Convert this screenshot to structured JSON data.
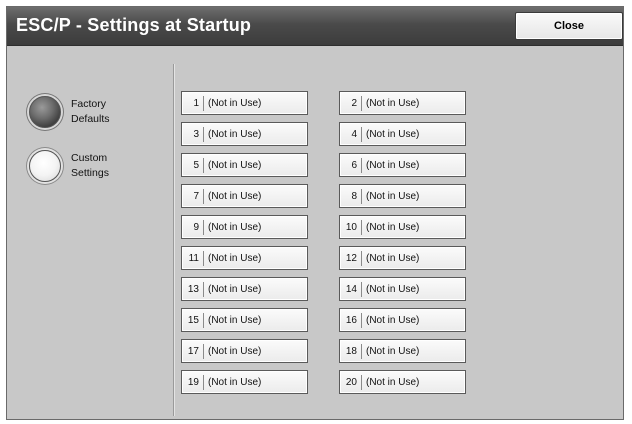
{
  "header": {
    "title": "ESC/P - Settings at Startup",
    "close_label": "Close"
  },
  "options": [
    {
      "label_line1": "Factory",
      "label_line2": "Defaults",
      "selected": true
    },
    {
      "label_line1": "Custom",
      "label_line2": "Settings",
      "selected": false
    }
  ],
  "settings": [
    {
      "num": "1",
      "label": "(Not in Use)"
    },
    {
      "num": "2",
      "label": "(Not in Use)"
    },
    {
      "num": "3",
      "label": "(Not in Use)"
    },
    {
      "num": "4",
      "label": "(Not in Use)"
    },
    {
      "num": "5",
      "label": "(Not in Use)"
    },
    {
      "num": "6",
      "label": "(Not in Use)"
    },
    {
      "num": "7",
      "label": "(Not in Use)"
    },
    {
      "num": "8",
      "label": "(Not in Use)"
    },
    {
      "num": "9",
      "label": "(Not in Use)"
    },
    {
      "num": "10",
      "label": "(Not in Use)"
    },
    {
      "num": "11",
      "label": "(Not in Use)"
    },
    {
      "num": "12",
      "label": "(Not in Use)"
    },
    {
      "num": "13",
      "label": "(Not in Use)"
    },
    {
      "num": "14",
      "label": "(Not in Use)"
    },
    {
      "num": "15",
      "label": "(Not in Use)"
    },
    {
      "num": "16",
      "label": "(Not in Use)"
    },
    {
      "num": "17",
      "label": "(Not in Use)"
    },
    {
      "num": "18",
      "label": "(Not in Use)"
    },
    {
      "num": "19",
      "label": "(Not in Use)"
    },
    {
      "num": "20",
      "label": "(Not in Use)"
    }
  ]
}
